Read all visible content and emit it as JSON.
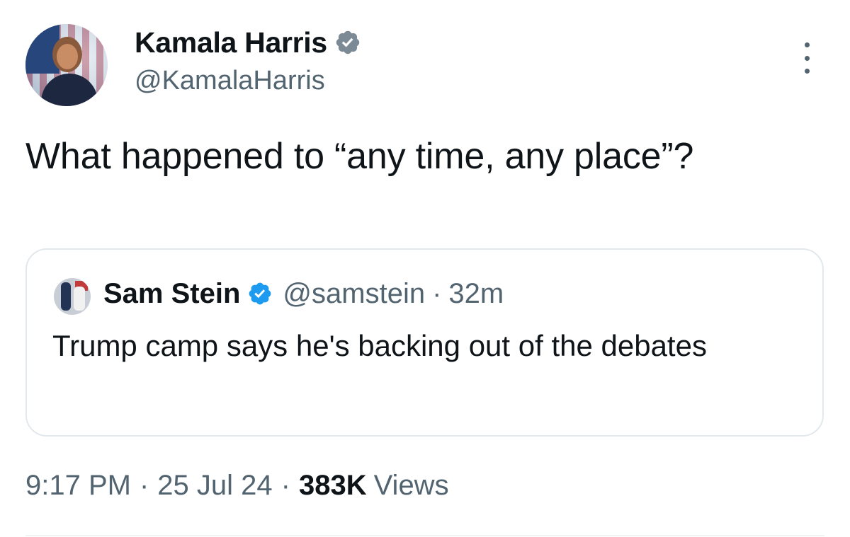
{
  "author": {
    "display_name": "Kamala Harris",
    "handle": "@KamalaHarris",
    "verified_icon": "verified-badge-icon",
    "badge_color": "#1d9bf0"
  },
  "tweet": {
    "text": "What happened to “any time, any place”?"
  },
  "quoted_tweet": {
    "display_name": "Sam Stein",
    "handle": "@samstein",
    "separator": "·",
    "time": "32m",
    "text": "Trump camp says he's backing out of the debates"
  },
  "meta": {
    "time": "9:17 PM",
    "separator": "·",
    "date": "25 Jul 24",
    "views_count": "383K",
    "views_label": "Views"
  },
  "icons": {
    "more": "more-horizontal-icon"
  }
}
